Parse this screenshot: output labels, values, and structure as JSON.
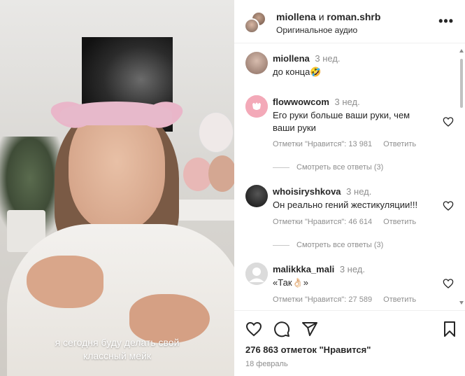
{
  "video": {
    "caption_line1": "я сегодня буду делать свой",
    "caption_line2": "классный мейк"
  },
  "header": {
    "user1": "miollena",
    "joiner": "и",
    "user2": "roman.shrb",
    "subtitle": "Оригинальное аудио",
    "more_icon": "more-horizontal-icon",
    "more_glyph": "•••"
  },
  "comments": [
    {
      "user": "miollena",
      "time": "3 нед.",
      "text": "до конца🤣",
      "avatar_color": "#b79a8b"
    },
    {
      "user": "flowwowcom",
      "time": "3 нед.",
      "text": "Его руки больше ваши руки, чем ваши руки",
      "likes": "Отметки \"Нравится\": 13 981",
      "reply": "Ответить",
      "view_replies": "Смотреть все ответы (3)",
      "avatar_color": "#f0a7b4"
    },
    {
      "user": "whoisiryshkova",
      "time": "3 нед.",
      "text": "Он реально гений жестикуляции!!!",
      "likes": "Отметки \"Нравится\": 46 614",
      "reply": "Ответить",
      "view_replies": "Смотреть все ответы (3)",
      "avatar_color": "#2b2b2b"
    },
    {
      "user": "malikkka_mali",
      "time": "3 нед.",
      "text": "«Так👌🏻»",
      "likes": "Отметки \"Нравится\": 27 589",
      "reply": "Ответить",
      "avatar_color": "#dbdbdb"
    }
  ],
  "footer": {
    "likes": "276 863 отметок \"Нравится\"",
    "date": "18 февраль"
  },
  "colors": {
    "text": "#262626",
    "secondary": "#8e8e8e",
    "border": "#efefef"
  }
}
